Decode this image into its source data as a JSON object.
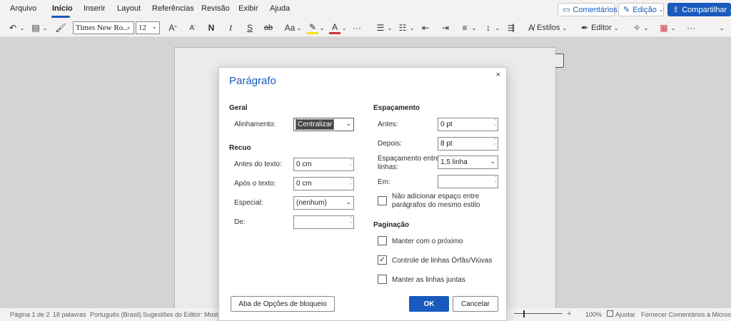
{
  "menu": {
    "items": [
      "Arquivo",
      "Início",
      "Inserir",
      "Layout",
      "Referências",
      "Revisão",
      "Exibir",
      "Ajuda"
    ],
    "comments_label": "Comentários",
    "editing_label": "Edição",
    "share_label": "Compartilhar"
  },
  "toolbar": {
    "font_name": "Times New Ro...",
    "font_size": "12",
    "styles_label": "Estilos",
    "editor_label": "Editor",
    "case_label": "Aa",
    "grow_label": "A",
    "shrink_label": "A",
    "bold": "N",
    "italic": "I",
    "underline": "S",
    "strike": "ab",
    "font_color": "A",
    "more": "···"
  },
  "dialog": {
    "title": "Parágrafo",
    "close": "×",
    "geral": {
      "section": "Geral",
      "alignment_label": "Alinhamento:",
      "alignment_value": "Centralizar"
    },
    "recuo": {
      "section": "Recuo",
      "before_label": "Antes do texto:",
      "before_value": "0 cm",
      "after_label": "Após o texto:",
      "after_value": "0 cm",
      "special_label": "Especial:",
      "special_value": "(nenhum)",
      "by_label": "De:",
      "by_value": ""
    },
    "espacamento": {
      "section": "Espaçamento",
      "before_label": "Antes:",
      "before_value": "0 pt",
      "after_label": "Depois:",
      "after_value": "8 pt",
      "line_label_1": "Espaçamento entre",
      "line_label_2": "linhas:",
      "line_value": "1,5 linha",
      "at_label": "Em:",
      "at_value": "",
      "no_space_label_1": "Não adicionar espaço entre",
      "no_space_label_2": "parágrafos do mesmo estilo",
      "no_space_checked": false
    },
    "paginacao": {
      "section": "Paginação",
      "keep_next_label": "Manter com o próximo",
      "keep_next_checked": false,
      "widow_label": "Controle de linhas Órfãs/Viúvas",
      "widow_checked": true,
      "keep_lines_label": "Manter as linhas juntas",
      "keep_lines_checked": false
    },
    "buttons": {
      "lock_tab": "Aba de Opções de bloqueio",
      "ok": "OK",
      "cancel": "Cancelar"
    }
  },
  "status": {
    "page": "Página 1 de 2",
    "words": "18 palavras",
    "language": "Português (Brasil)",
    "suggestions": "Sugestões do Editor: Mostrando",
    "zoom_plus": "+",
    "zoom": "100%",
    "fit": "Ajustar",
    "feedback": "Fornecer Comentários à Microsoft"
  },
  "colors": {
    "accent": "#185abd",
    "highlight": "#f2e600",
    "font_color": "#d13438"
  }
}
